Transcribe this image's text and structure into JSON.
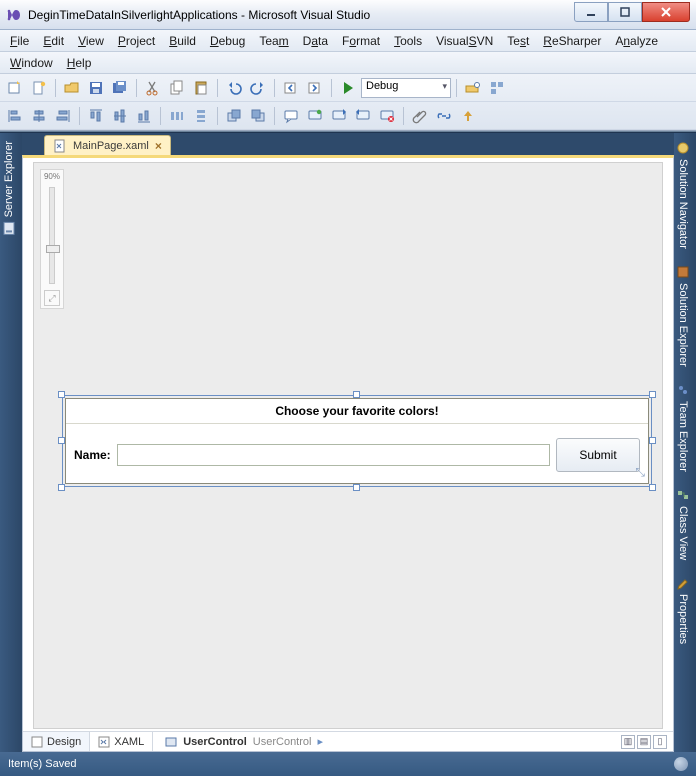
{
  "window": {
    "title": "DeginTimeDataInSilverlightApplications - Microsoft Visual Studio"
  },
  "menu": {
    "row1": [
      "File",
      "Edit",
      "View",
      "Project",
      "Build",
      "Debug",
      "Team",
      "Data",
      "Format",
      "Tools",
      "VisualSVN",
      "Test",
      "ReSharper",
      "Analyze"
    ],
    "row2": [
      "Window",
      "Help"
    ]
  },
  "toolbar": {
    "config_combo": "Debug"
  },
  "rails": {
    "left": {
      "server_explorer": "Server Explorer"
    },
    "right": {
      "solution_navigator": "Solution Navigator",
      "solution_explorer": "Solution Explorer",
      "team_explorer": "Team Explorer",
      "class_view": "Class View",
      "properties": "Properties"
    }
  },
  "doc": {
    "tab_label": "MainPage.xaml"
  },
  "zoom": {
    "percent": "90%"
  },
  "designer": {
    "form_title": "Choose your favorite colors!",
    "name_label": "Name:",
    "submit_label": "Submit"
  },
  "bottom_tabs": {
    "design": "Design",
    "xaml": "XAML",
    "breadcrumb_icon": "UserControl",
    "breadcrumb_text": "UserControl"
  },
  "status": {
    "text": "Item(s) Saved"
  }
}
